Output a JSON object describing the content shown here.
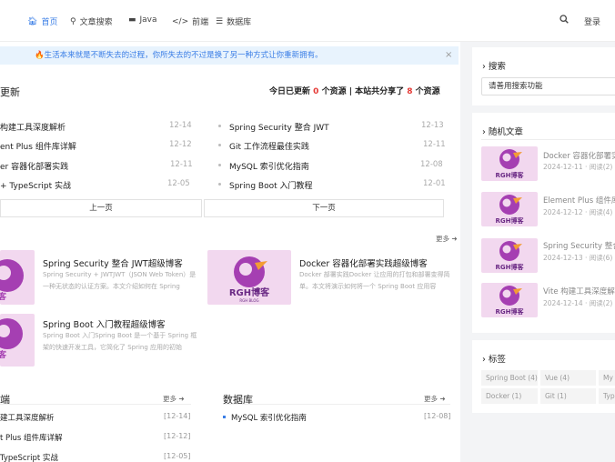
{
  "nav": {
    "items": [
      {
        "label": "首页",
        "icon": "home-icon"
      },
      {
        "label": "文章搜索",
        "icon": "search-icon"
      },
      {
        "label": "Java",
        "icon": "book-icon"
      },
      {
        "label": "前端",
        "icon": "code-icon"
      },
      {
        "label": "数据库",
        "icon": "database-icon"
      }
    ],
    "login": "登录",
    "accent": "#3a7ee6"
  },
  "notice": {
    "text": "🔥生活本来就是不断失去的过程，你所失去的不过是换了另一种方式让你重新拥有。",
    "close": "×"
  },
  "updates": {
    "title": "更新",
    "stat_prefix": "今日已更新",
    "today_count": "0",
    "stat_mid": "个资源 | 本站共分享了",
    "total_count": "8",
    "stat_suffix": "个资源",
    "left": [
      {
        "title": "构建工具深度解析",
        "date": "12-14"
      },
      {
        "title": "ent Plus 组件库详解",
        "date": "12-12"
      },
      {
        "title": "er 容器化部署实践",
        "date": "12-11"
      },
      {
        "title": "+ TypeScript 实战",
        "date": "12-05"
      }
    ],
    "right": [
      {
        "title": "Spring Security 整合 JWT",
        "date": "12-13"
      },
      {
        "title": "Git 工作流程最佳实践",
        "date": "12-11"
      },
      {
        "title": "MySQL 索引优化指南",
        "date": "12-08"
      },
      {
        "title": "Spring Boot 入门教程",
        "date": "12-01"
      }
    ],
    "prev": "上一页",
    "next": "下一页"
  },
  "featured": {
    "more": "更多",
    "cards": [
      {
        "title": "Spring Security 整合 JWT超级博客",
        "desc": "Spring Security + JWTJWT（JSON Web Token）是一种无状态的认证方案。本文介绍如何在 Spring"
      },
      {
        "title": "Docker 容器化部署实践超级博客",
        "desc": "Docker 部署实践Docker 让应用的打包和部署变得简单。本文将演示如何将一个 Spring Boot 应用容"
      },
      {
        "title": "Spring Boot 入门教程超级博客",
        "desc": "Spring Boot 入门Spring Boot 是一个基于 Spring 框架的快速开发工具，它简化了 Spring 应用的初始"
      }
    ],
    "logo_text": "RGH博客",
    "logo_sub": "RGH BLOG"
  },
  "sections": {
    "frontend": {
      "title": "端",
      "more": "更多",
      "items": [
        {
          "title": "建工具深度解析",
          "date": "[12-14]"
        },
        {
          "title": "t Plus 组件库详解",
          "date": "[12-12]"
        },
        {
          "title": "TypeScript 实战",
          "date": "[12-05]"
        }
      ]
    },
    "database": {
      "title": "数据库",
      "more": "更多",
      "items": [
        {
          "title": "MySQL 索引优化指南",
          "date": "[12-08]"
        }
      ]
    }
  },
  "sidebar": {
    "search_title": "搜索",
    "search_placeholder": "请善用搜索功能",
    "random_title": "随机文章",
    "articles": [
      {
        "title": "Docker 容器化部署实",
        "meta": "2024-12-11 · 阅读(2)"
      },
      {
        "title": "Element Plus 组件库",
        "meta": "2024-12-12 · 阅读(4)"
      },
      {
        "title": "Spring Security 整合",
        "meta": "2024-12-13 · 阅读(6)"
      },
      {
        "title": "Vite 构建工具深度解",
        "meta": "2024-12-14 · 阅读(2)"
      }
    ],
    "tags_title": "标签",
    "tags": [
      "Spring Boot (4)",
      "Vue (4)",
      "My",
      "Docker (1)",
      "Git (1)",
      "Typ"
    ]
  }
}
